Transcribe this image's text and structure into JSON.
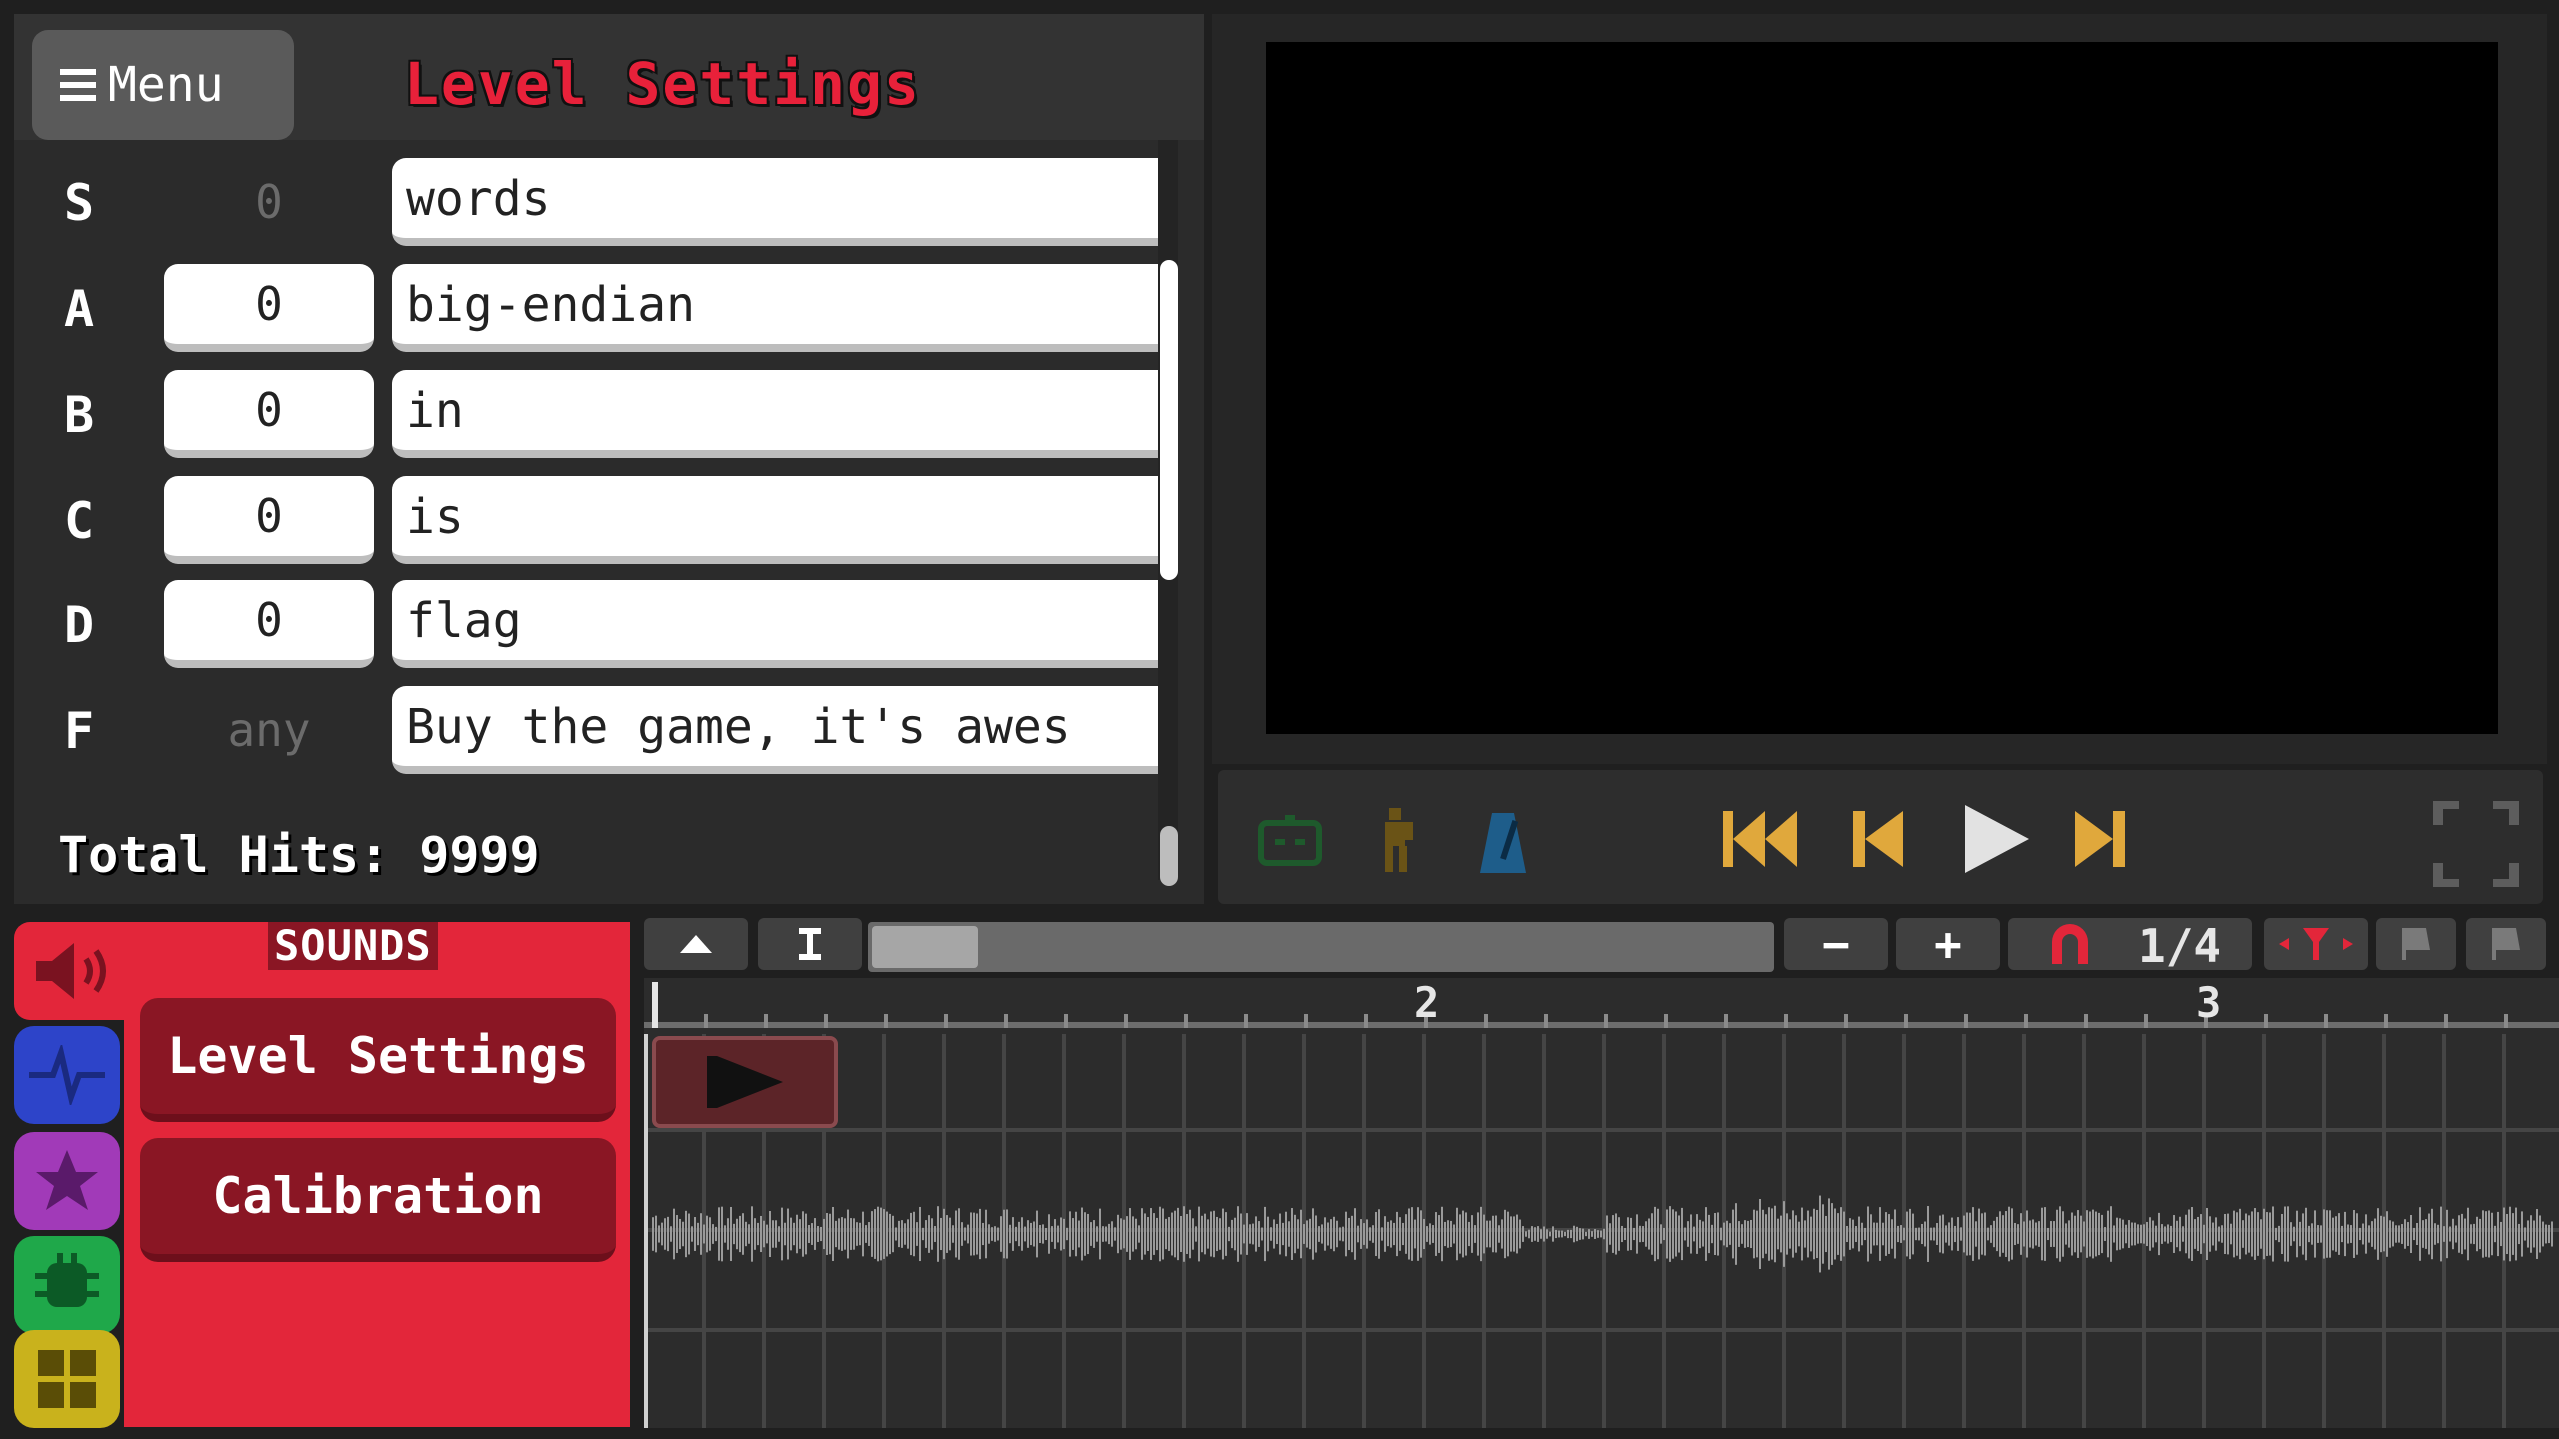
{
  "header": {
    "menu_label": "Menu",
    "title": "Level Settings"
  },
  "rows": [
    {
      "letter": "S",
      "hits": "0",
      "hits_editable": false,
      "text": "words"
    },
    {
      "letter": "A",
      "hits": "0",
      "hits_editable": true,
      "text": "big-endian"
    },
    {
      "letter": "B",
      "hits": "0",
      "hits_editable": true,
      "text": "in"
    },
    {
      "letter": "C",
      "hits": "0",
      "hits_editable": true,
      "text": "is"
    },
    {
      "letter": "D",
      "hits": "0",
      "hits_editable": true,
      "text": "flag"
    },
    {
      "letter": "F",
      "hits": "any",
      "hits_editable": false,
      "text": "Buy the game, it's awes"
    }
  ],
  "total_hits": "Total Hits: 9999",
  "sounds": {
    "title": "SOUNDS",
    "buttons": [
      "Level Settings",
      "Calibration"
    ]
  },
  "timeline": {
    "zoom": "1/4",
    "beats": [
      "2",
      "3"
    ],
    "plus": "+",
    "minus": "−"
  },
  "colors": {
    "accent_red": "#e3263a",
    "title_red": "#e8213a",
    "transport_gold": "#e0a83c",
    "tab_blue": "#2d44c9",
    "tab_purple": "#a13ab8",
    "tab_green": "#1fa84a",
    "tab_yellow": "#c9b21c"
  },
  "icons": {
    "menu": "hamburger-icon",
    "speaker": "speaker-icon",
    "pulse": "pulse-icon",
    "star": "star-icon",
    "bug": "bug-icon",
    "grid": "grid-icon"
  }
}
